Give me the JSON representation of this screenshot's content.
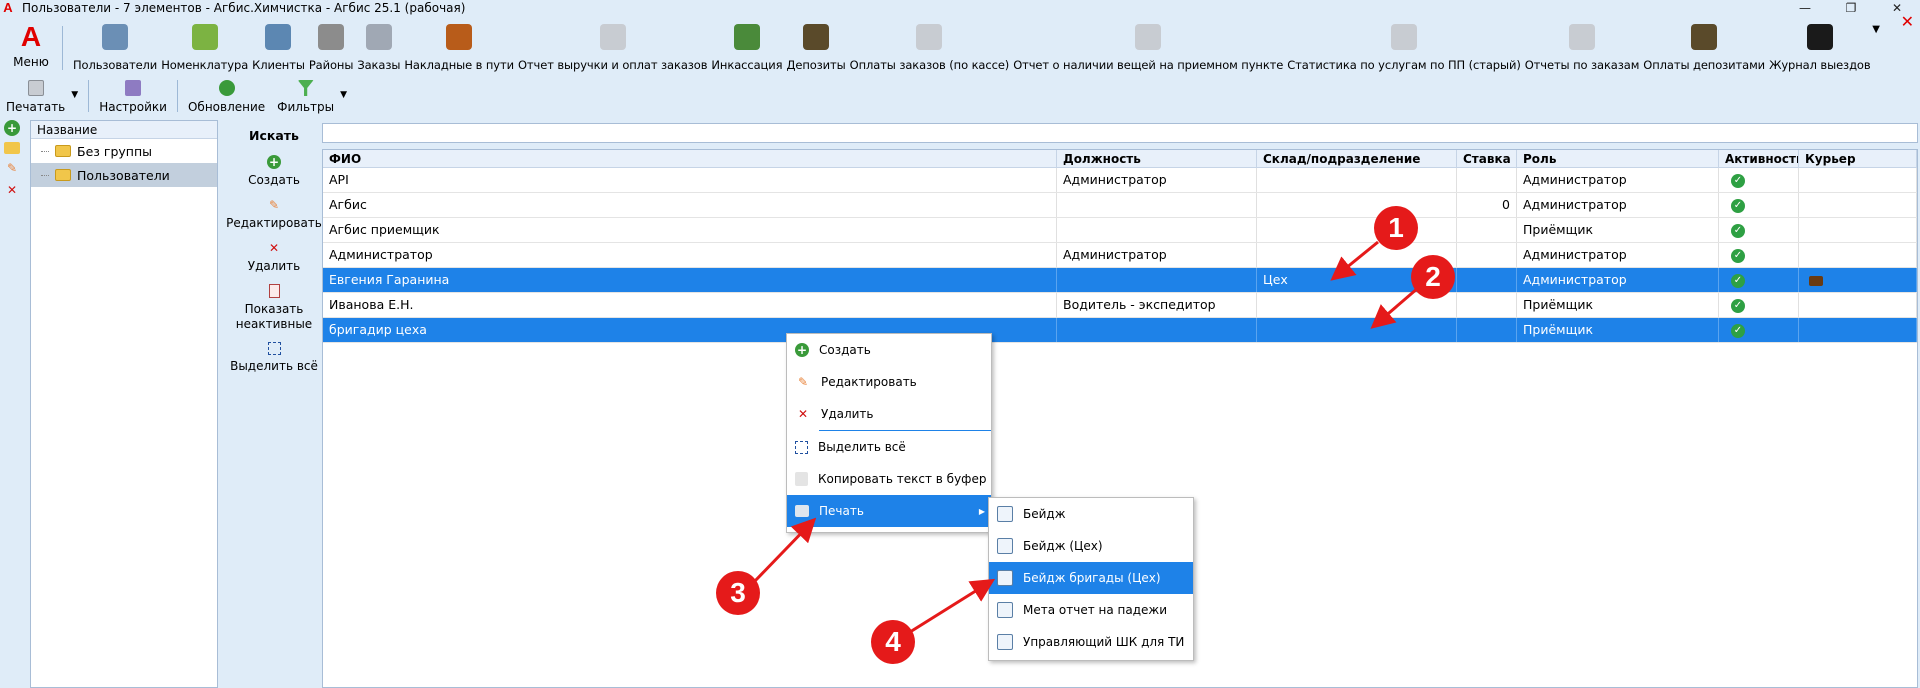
{
  "window": {
    "title": "Пользователи - 7 элементов - Агбис.Химчистка - Агбис 25.1 (рабочая)",
    "logo": "A"
  },
  "ribbon": {
    "menu_label": "Меню",
    "items": [
      {
        "label": "Пользователи",
        "icon": "users-icon",
        "color": "#6b8fb5"
      },
      {
        "label": "Номенклатура",
        "icon": "basket-icon",
        "color": "#7cb342"
      },
      {
        "label": "Клиенты",
        "icon": "clients-icon",
        "color": "#5c87b2"
      },
      {
        "label": "Районы",
        "icon": "buildings-icon",
        "color": "#8c8c8c"
      },
      {
        "label": "Заказы",
        "icon": "orders-icon",
        "color": "#a0a8b4"
      },
      {
        "label": "Накладные в пути",
        "icon": "truck-icon",
        "color": "#b85c1a"
      },
      {
        "label": "Отчет выручки и оплат заказов",
        "icon": "report-icon",
        "color": "#c8ccd2"
      },
      {
        "label": "Инкассация",
        "icon": "money-icon",
        "color": "#4a8a3a"
      },
      {
        "label": "Депозиты",
        "icon": "deposit-icon",
        "color": "#5a4a2a"
      },
      {
        "label": "Оплаты заказов (по кассе)",
        "icon": "report-icon",
        "color": "#c8ccd2"
      },
      {
        "label": "Отчет о наличии вещей на приемном пункте",
        "icon": "report-icon",
        "color": "#c8ccd2"
      },
      {
        "label": "Статистика по услугам по ПП (старый)",
        "icon": "report-icon",
        "color": "#c8ccd2"
      },
      {
        "label": "Отчеты по заказам",
        "icon": "reports-icon",
        "color": "#c8ccd2"
      },
      {
        "label": "Оплаты депозитами",
        "icon": "deposit-pay-icon",
        "color": "#5a4a2a"
      },
      {
        "label": "Журнал выездов",
        "icon": "journal-icon",
        "color": "#1a1a1a"
      }
    ]
  },
  "toolbar": {
    "print": "Печатать",
    "settings": "Настройки",
    "refresh": "Обновление",
    "filters": "Фильтры"
  },
  "tree": {
    "header": "Название",
    "items": [
      {
        "label": "Без группы",
        "selected": false
      },
      {
        "label": "Пользователи",
        "selected": true
      }
    ]
  },
  "actions": {
    "title": "Искать",
    "create": "Создать",
    "edit": "Редактировать",
    "delete": "Удалить",
    "show_inactive_1": "Показать",
    "show_inactive_2": "неактивные",
    "select_all": "Выделить всё"
  },
  "search": {
    "value": ""
  },
  "grid": {
    "columns": [
      "ФИО",
      "Должность",
      "Склад/подразделение",
      "Ставка",
      "Роль",
      "Активность",
      "Курьер"
    ],
    "rows": [
      {
        "fio": "API",
        "position": "Администратор",
        "warehouse": "",
        "rate": "",
        "role": "Администратор",
        "active": true,
        "courier": false,
        "selected": false
      },
      {
        "fio": "Агбис",
        "position": "",
        "warehouse": "",
        "rate": "0",
        "role": "Администратор",
        "active": true,
        "courier": false,
        "selected": false
      },
      {
        "fio": "Агбис приемщик",
        "position": "",
        "warehouse": "",
        "rate": "",
        "role": "Приёмщик",
        "active": true,
        "courier": false,
        "selected": false
      },
      {
        "fio": "Администратор",
        "position": "Администратор",
        "warehouse": "",
        "rate": "",
        "role": "Администратор",
        "active": true,
        "courier": false,
        "selected": false
      },
      {
        "fio": "Евгения Гаранина",
        "position": "",
        "warehouse": "Цех",
        "rate": "",
        "role": "Администратор",
        "active": true,
        "courier": true,
        "selected": true
      },
      {
        "fio": "Иванова Е.Н.",
        "position": "Водитель - экспедитор",
        "warehouse": "",
        "rate": "",
        "role": "Приёмщик",
        "active": true,
        "courier": false,
        "selected": false
      },
      {
        "fio": "бригадир цеха",
        "position": "",
        "warehouse": "",
        "rate": "",
        "role": "Приёмщик",
        "active": true,
        "courier": false,
        "selected": true
      }
    ]
  },
  "context_menu": {
    "create": "Создать",
    "edit": "Редактировать",
    "delete": "Удалить",
    "select_all": "Выделить всё",
    "copy": "Копировать текст в буфер",
    "print": "Печать"
  },
  "print_submenu": {
    "items": [
      {
        "label": "Бейдж",
        "active": false
      },
      {
        "label": "Бейдж (Цех)",
        "active": false
      },
      {
        "label": "Бейдж бригады (Цех)",
        "active": true
      },
      {
        "label": "Мета отчет на падежи",
        "active": false
      },
      {
        "label": "Управляющий ШК для ТИ",
        "active": false
      }
    ]
  },
  "annotations": [
    "1",
    "2",
    "3",
    "4"
  ],
  "colors": {
    "selection": "#1e82e8",
    "annotation": "#e51a1a",
    "check": "#2ea043"
  }
}
